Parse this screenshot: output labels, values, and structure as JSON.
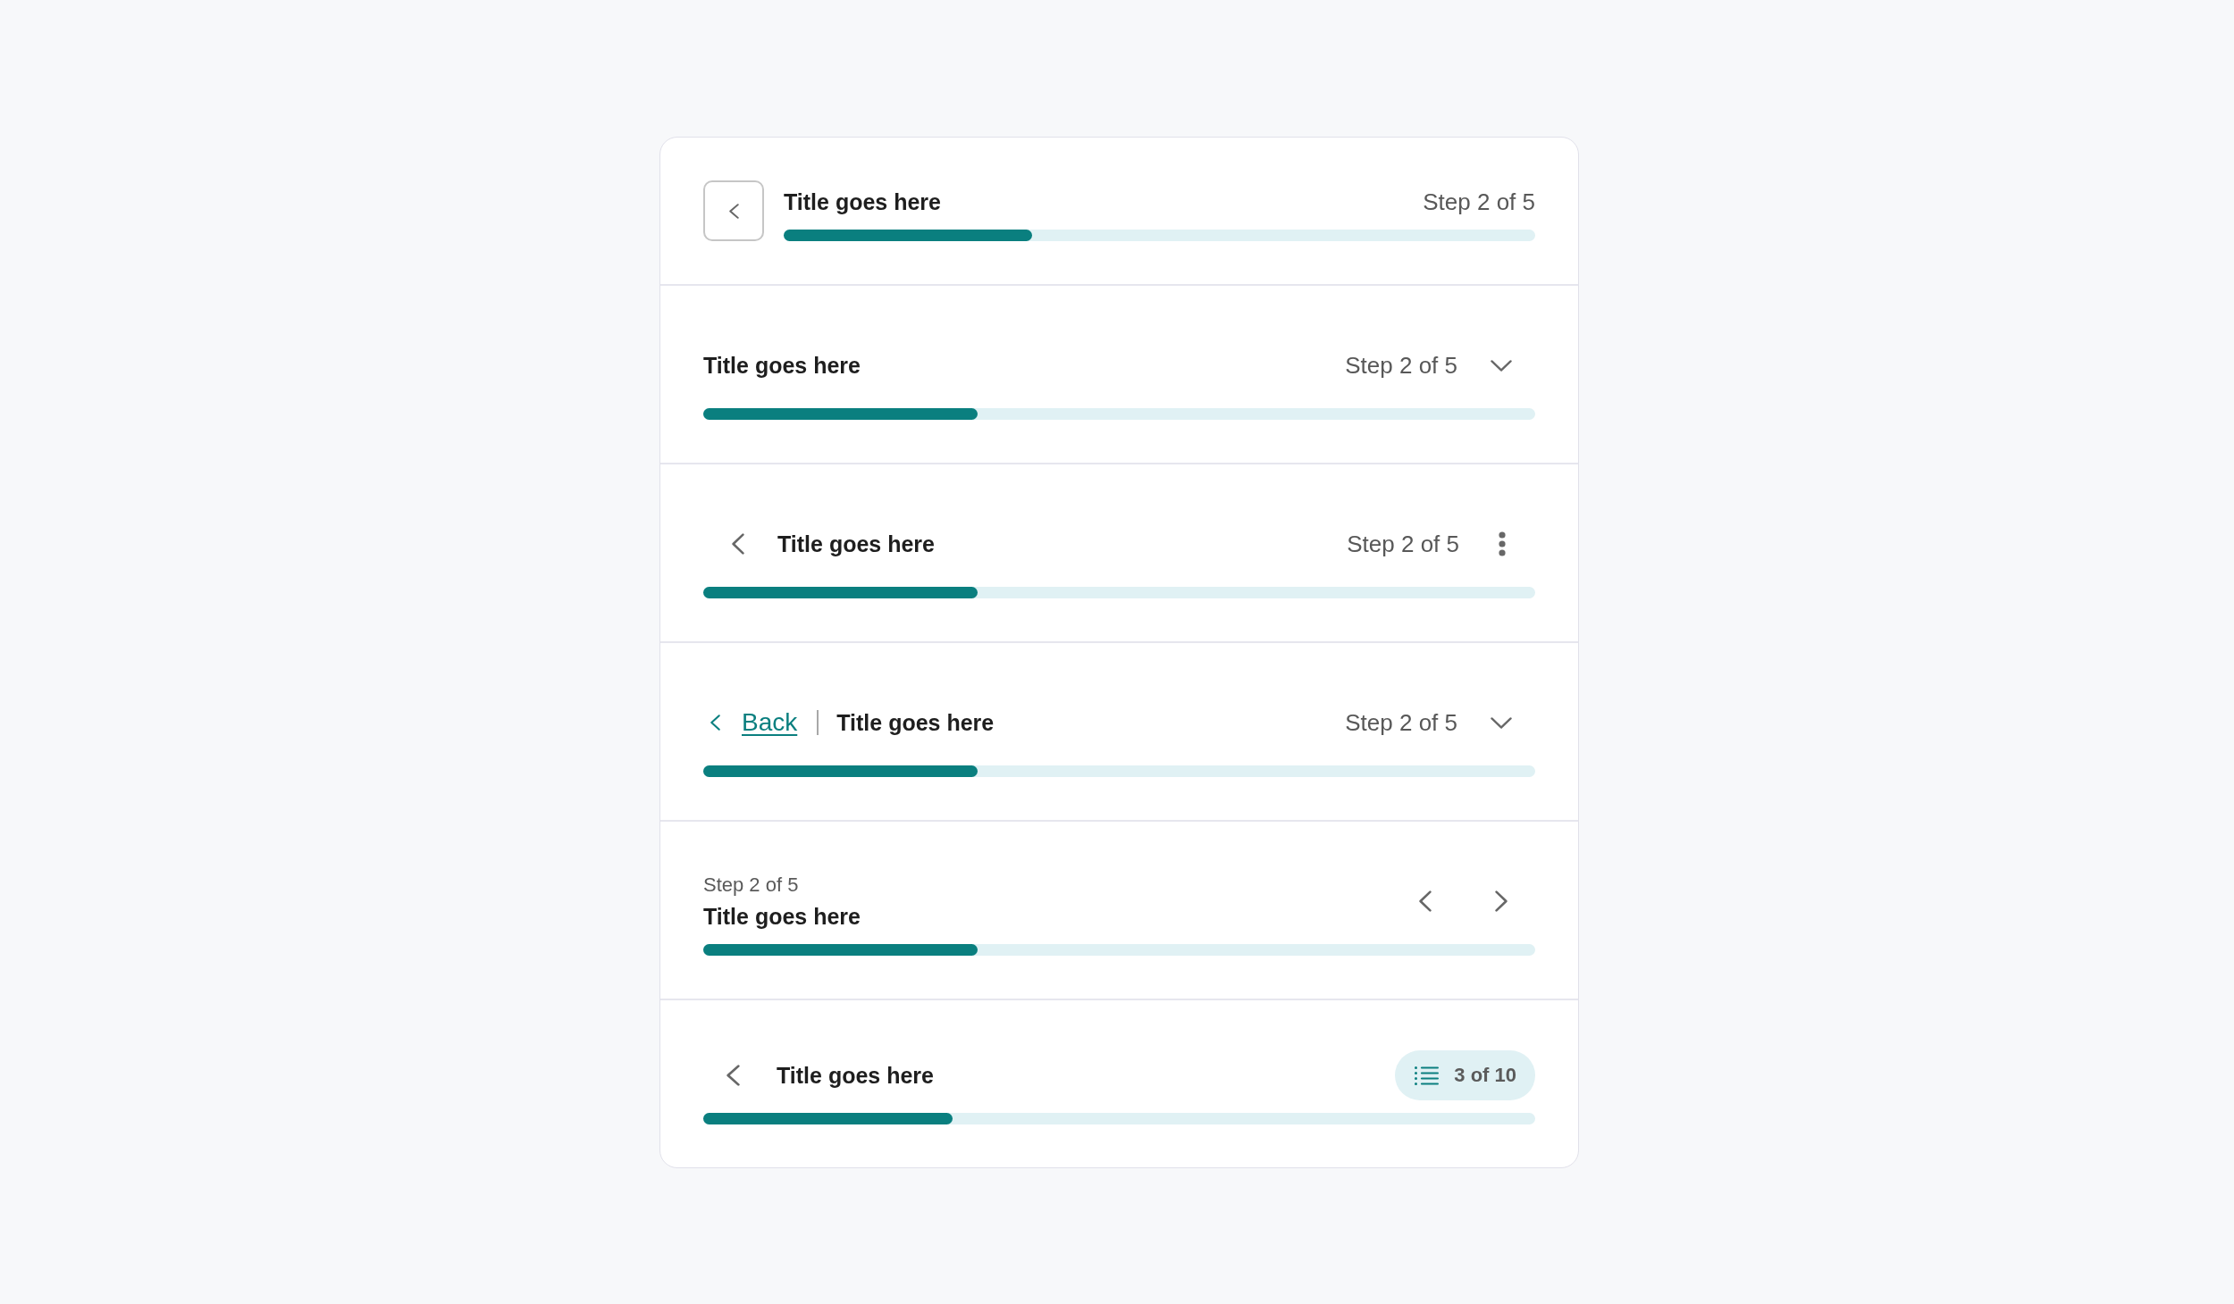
{
  "progress_headers": [
    {
      "kind": "boxed-back",
      "title": "Title goes here",
      "step": "Step 2 of 5",
      "level": 0.33
    },
    {
      "kind": "dropdown",
      "title": "Title goes here",
      "step": "Step 2 of 5",
      "level": 0.33
    },
    {
      "kind": "overflow-menu",
      "title": "Title goes here",
      "step": "Step 2 of 5",
      "level": 0.33
    },
    {
      "kind": "back-link",
      "back_link": "Back",
      "title": "Title goes here",
      "step": "Step 2 of 5",
      "level": 0.33
    },
    {
      "kind": "pager",
      "step": "Step 2 of 5",
      "title": "Title goes here",
      "level": 0.33
    },
    {
      "kind": "counter",
      "title": "Title goes here",
      "counter": "3 of 10",
      "level": 0.3
    }
  ]
}
